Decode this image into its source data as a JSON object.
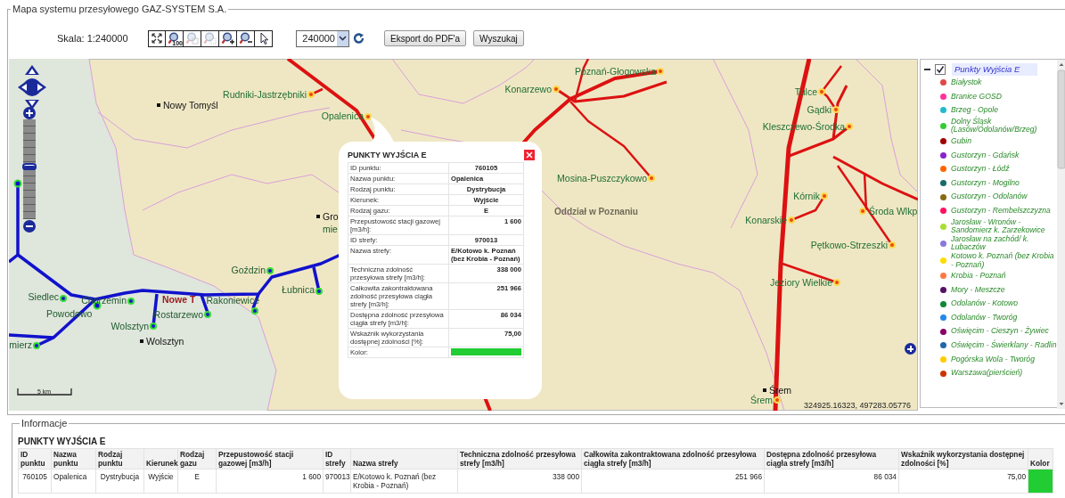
{
  "panel": {
    "title": "Mapa systemu przesyłowego GAZ-SYSTEM S.A."
  },
  "toolbar": {
    "scale_label": "Skala: 1:240000",
    "tools": [
      {
        "kind": "full-extent",
        "disabled": false
      },
      {
        "kind": "zoom-100",
        "badge": "100",
        "disabled": false
      },
      {
        "kind": "zoom-previous",
        "disabled": true
      },
      {
        "kind": "zoom-next",
        "disabled": true
      },
      {
        "kind": "zoom-in",
        "disabled": false
      },
      {
        "kind": "zoom-out",
        "disabled": false
      },
      {
        "kind": "pointer",
        "disabled": false
      }
    ],
    "scale_select": {
      "value": "240000"
    },
    "buttons": [
      "Eksport do PDF'a",
      "Wyszukaj"
    ]
  },
  "map": {
    "zoom_slider": {
      "level": 0.53
    },
    "labels": [
      {
        "text": "Rudniki-Jastrzębniki",
        "kind": "station"
      },
      {
        "text": "Nowy Tomyśl",
        "kind": "town"
      },
      {
        "text": "Opalenica",
        "kind": "station"
      },
      {
        "text": "Poznań-Głogowska",
        "kind": "station"
      },
      {
        "text": "Konarzewo",
        "kind": "station"
      },
      {
        "text": "Tulce",
        "kind": "station"
      },
      {
        "text": "Gądki",
        "kind": "station"
      },
      {
        "text": "Kleszczewo-Środka",
        "kind": "station"
      },
      {
        "text": "Mosina-Puszczykowo",
        "kind": "station"
      },
      {
        "text": "Oddział w Poznaniu",
        "kind": "region"
      },
      {
        "text": "Kórnik",
        "kind": "station"
      },
      {
        "text": "Konarskie",
        "kind": "station"
      },
      {
        "text": "Środa Wlkp",
        "kind": "station"
      },
      {
        "text": "Pętkowo-Strzeszki",
        "kind": "station"
      },
      {
        "text": "Jeziory Wielkie",
        "kind": "station"
      },
      {
        "text": "Śrem",
        "kind": "town"
      },
      {
        "text": "Śrem",
        "kind": "station"
      },
      {
        "text": "Gro",
        "kind": "town"
      },
      {
        "text": "mie",
        "kind": "place"
      },
      {
        "text": "Goździn",
        "kind": "node"
      },
      {
        "text": "Łubnica",
        "kind": "node"
      },
      {
        "text": "Siedlec",
        "kind": "node"
      },
      {
        "text": "Chorzemin",
        "kind": "node"
      },
      {
        "text": "Powodowo",
        "kind": "place"
      },
      {
        "text": "Nowe T",
        "kind": "settlement"
      },
      {
        "text": "Rakoniewice",
        "kind": "node"
      },
      {
        "text": "Rostarzewo",
        "kind": "node"
      },
      {
        "text": "Wolsztyn",
        "kind": "node"
      },
      {
        "text": "Wolsztyn",
        "kind": "town"
      },
      {
        "text": "mierz",
        "kind": "node"
      }
    ],
    "scale_bar": "5 km",
    "coordinates": "324925.16323, 497283.05776",
    "popup": {
      "title": "PUNKTY WYJŚCIA E",
      "rows": [
        {
          "label": "ID punktu:",
          "value": "760105"
        },
        {
          "label": "Nazwa punktu:",
          "value": "Opalenica"
        },
        {
          "label": "Rodzaj punktu:",
          "value": "Dystrybucja"
        },
        {
          "label": "Kierunek:",
          "value": "Wyjście"
        },
        {
          "label": "Rodzaj gazu:",
          "value": "E"
        },
        {
          "label": "Przepustowość stacji gazowej [m3/h]:",
          "value": "1 600"
        },
        {
          "label": "ID strefy:",
          "value": "970013"
        },
        {
          "label": "Nazwa strefy:",
          "value": "E/Kotowo k. Poznań (bez Krobia - Poznań)"
        },
        {
          "label": "Techniczna zdolność przesyłowa strefy [m3/h]:",
          "value": "338 000"
        },
        {
          "label": "Całkowita zakontraktowana zdolność przesyłowa ciągła strefy [m3/h]:",
          "value": "251 966"
        },
        {
          "label": "Dostępna zdolność przesyłowa ciągła strefy [m3/h]:",
          "value": "86 034"
        },
        {
          "label": "Wskaźnik wykorzystania dostępnej zdolności [%]:",
          "value": "75,00"
        }
      ],
      "color_label": "Kolor:",
      "color": "#22cc33"
    }
  },
  "layers": {
    "group": {
      "label": "Punkty Wyjścia E",
      "checked": true,
      "expanded": true,
      "children": [
        {
          "label": "Białystok",
          "color": "#e04848"
        },
        {
          "label": "Branice GOSD",
          "color": "#ff3399"
        },
        {
          "label": "Brzeg - Opole",
          "color": "#22bbcc"
        },
        {
          "label": "Dolny Śląsk (Lasów/Odolanów/Brzeg)",
          "color": "#33cc33"
        },
        {
          "label": "Gubin",
          "color": "#a00000"
        },
        {
          "label": "Gustorzyn - Gdańsk",
          "color": "#8822cc"
        },
        {
          "label": "Gustorzyn - Łódź",
          "color": "#ff6600"
        },
        {
          "label": "Gustorzyn - Mogilno",
          "color": "#1a6a6a"
        },
        {
          "label": "Gustorzyn - Odolanów",
          "color": "#8a6a10"
        },
        {
          "label": "Gustorzyn - Rembelszczyzna",
          "color": "#ff1060"
        },
        {
          "label": "Jarosław - Wronów - Sandomierz k. Zarzekowice",
          "color": "#aadd33"
        },
        {
          "label": "Jarosław na zachód/ k. Lubaczów",
          "color": "#8877dd"
        },
        {
          "label": "Kotowo k. Poznań (bez Krobia - Poznań)",
          "color": "#ffdd00"
        },
        {
          "label": "Krobia - Poznań",
          "color": "#ff7744"
        },
        {
          "label": "Mory - Meszcze",
          "color": "#551166"
        },
        {
          "label": "Odolanów - Kotowo",
          "color": "#118833"
        },
        {
          "label": "Odolanów - Tworóg",
          "color": "#2288ee"
        },
        {
          "label": "Oświęcim - Cieszyn - Żywiec",
          "color": "#880066"
        },
        {
          "label": "Oświęcim - Świerklany - Radlin",
          "color": "#2266aa"
        },
        {
          "label": "Pogórska Wola - Tworóg",
          "color": "#ffcc00"
        },
        {
          "label": "Warszawa(pierścień)",
          "color": "#cc3300"
        }
      ]
    }
  },
  "info": {
    "title": "Informacje",
    "table_title": "PUNKTY WYJŚCIA E",
    "columns": [
      "ID punktu",
      "Nazwa punktu",
      "Rodzaj punktu",
      "Kierunek",
      "Rodzaj gazu",
      "Przepustowość stacji gazowej [m3/h]",
      "ID strefy",
      "Nazwa strefy",
      "Techniczna zdolność przesyłowa strefy [m3/h]",
      "Całkowita zakontraktowana zdolność przesyłowa ciągła strefy [m3/h]",
      "Dostępna zdolność przesyłowa ciągła strefy [m3/h]",
      "Wskaźnik wykorzystania dostępnej zdolności [%]",
      "Kolor"
    ],
    "rows": [
      {
        "cells": [
          "760105",
          "Opalenica",
          "Dystrybucja",
          "Wyjście",
          "E",
          "1 600",
          "970013",
          "E/Kotowo k. Poznań (bez Krobia - Poznań)",
          "338 000",
          "251 966",
          "86 034",
          "75,00"
        ],
        "color": "#22cc33"
      }
    ]
  }
}
